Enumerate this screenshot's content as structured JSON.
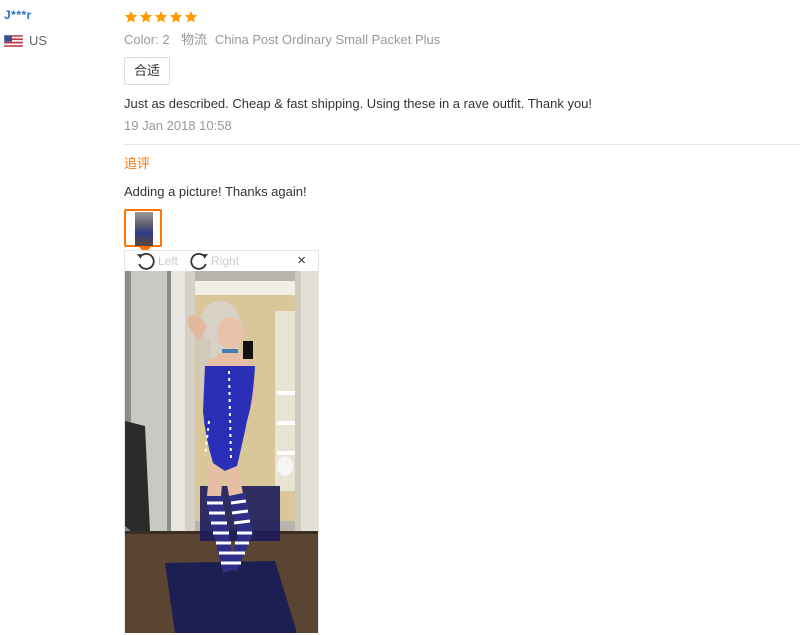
{
  "user": {
    "name": "J***r",
    "country": "US"
  },
  "review": {
    "rating": 5,
    "color_label": "Color:",
    "color_value": "2",
    "shipping_label": "物流",
    "shipping_value": "China Post Ordinary Small Packet Plus",
    "fit_tag": "合适",
    "text": "Just as described. Cheap & fast shipping. Using these in a rave outfit. Thank you!",
    "date": "19 Jan 2018 10:58"
  },
  "followup": {
    "label": "追评",
    "text": "Adding a picture! Thanks again!"
  },
  "viewer": {
    "rotate_left": "Left",
    "rotate_right": "Right",
    "close": "×"
  },
  "colors": {
    "accent": "#ff7300",
    "star": "#ff9a00",
    "username": "#2e6fbf"
  }
}
